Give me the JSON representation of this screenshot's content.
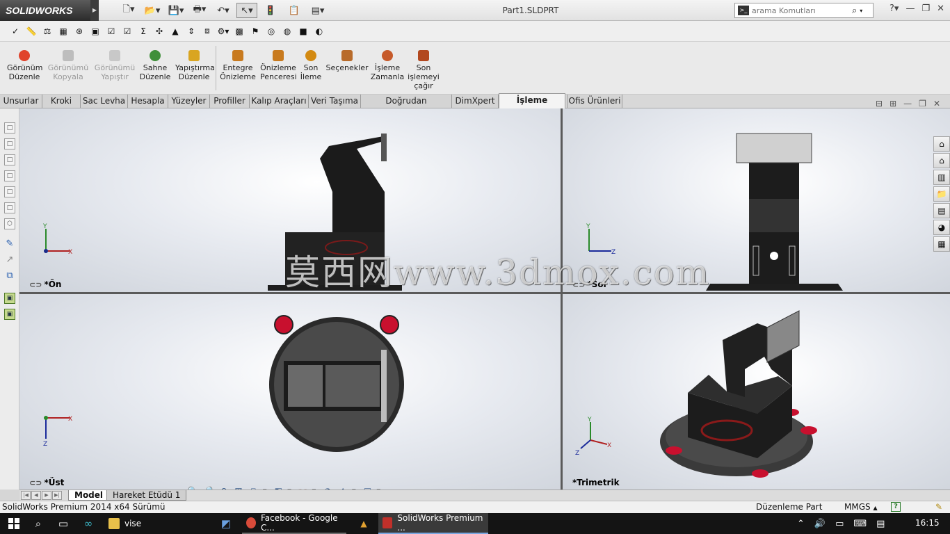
{
  "app": {
    "logo": "SOLIDWORKS",
    "document_title": "Part1.SLDPRT"
  },
  "search": {
    "placeholder": "arama Komutları"
  },
  "command_manager": [
    {
      "label": "Görünüm\nDüzenle",
      "enabled": true,
      "color": "#e0442c"
    },
    {
      "label": "Görünümü\nKopyala",
      "enabled": false,
      "color": "#9a9a9a"
    },
    {
      "label": "Görünümü\nYapıştır",
      "enabled": false,
      "color": "#9a9a9a"
    },
    {
      "label": "Sahne\nDüzenle",
      "enabled": true,
      "color": "#3f8f3a"
    },
    {
      "label": "Yapıştırma\nDüzenle",
      "enabled": true,
      "color": "#d9a521"
    },
    {
      "label": "Entegre\nÖnizleme",
      "enabled": true,
      "color": "#c87a1e"
    },
    {
      "label": "Önizleme\nPenceresi",
      "enabled": true,
      "color": "#c87a1e"
    },
    {
      "label": "Son\nİleme",
      "enabled": true,
      "color": "#d38a12"
    },
    {
      "label": "Seçenekler",
      "enabled": true,
      "color": "#b86b2a"
    },
    {
      "label": "İşleme\nZamanla",
      "enabled": true,
      "color": "#c65a2a"
    },
    {
      "label": "Son\nişlemeyi\nçağır",
      "enabled": true,
      "color": "#b2481f"
    }
  ],
  "tabs": [
    {
      "label": "Unsurlar",
      "active": false
    },
    {
      "label": "Kroki",
      "active": false
    },
    {
      "label": "Sac Levha",
      "active": false
    },
    {
      "label": "Hesapla",
      "active": false
    },
    {
      "label": "Yüzeyler",
      "active": false
    },
    {
      "label": "Profiller",
      "active": false
    },
    {
      "label": "Kalıp Araçları",
      "active": false
    },
    {
      "label": "Veri Taşıma",
      "active": false
    },
    {
      "label": "Doğrudan Düzenleme",
      "active": false
    },
    {
      "label": "DimXpert",
      "active": false
    },
    {
      "label": "İşleme Araçları",
      "active": true
    },
    {
      "label": "Ofis Ürünleri",
      "active": false
    }
  ],
  "viewports": [
    {
      "label": "*Ön",
      "axes": [
        "Y",
        "X"
      ]
    },
    {
      "label": "*Sol",
      "axes": [
        "Y",
        "Z"
      ]
    },
    {
      "label": "*Üst",
      "axes": [
        "X",
        "Z"
      ]
    },
    {
      "label": "*Trimetrik",
      "axes": [
        "Y",
        "X",
        "Z"
      ]
    }
  ],
  "watermark": "莫西网www.3dmox.com",
  "bottom_tabs": [
    {
      "label": "Model",
      "active": true
    },
    {
      "label": "Hareket Etüdü 1",
      "active": false
    }
  ],
  "status": {
    "version": "SolidWorks Premium 2014 x64 Sürümü",
    "mode": "Düzenleme Part",
    "units": "MMGS",
    "units_caret": "▲",
    "help": "?"
  },
  "taskbar": {
    "apps": [
      {
        "label": "vise",
        "state": "normal",
        "color": "#e8c04a"
      },
      {
        "label": "Facebook - Google C...",
        "state": "running",
        "color": "#d84b3a"
      },
      {
        "label": "SolidWorks Premium ...",
        "state": "active",
        "color": "#c0302a"
      }
    ],
    "time": "16:15"
  },
  "colors": {
    "accent_red": "#c8102e",
    "model_black": "#1e1e1e",
    "viewport_top": "#ffffff"
  }
}
